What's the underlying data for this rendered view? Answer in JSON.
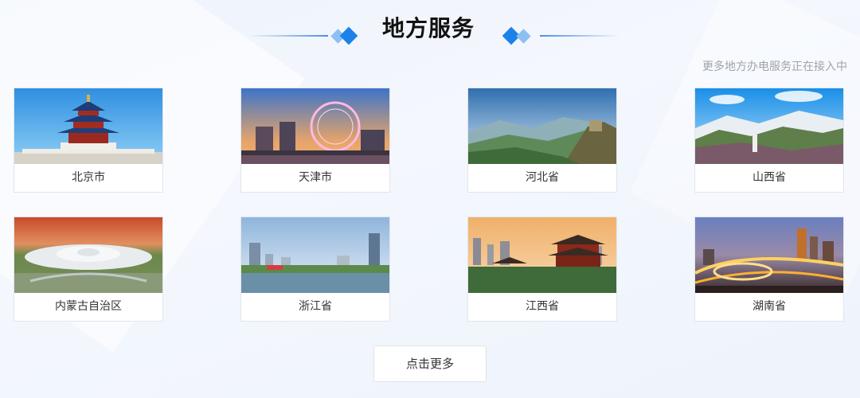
{
  "header": {
    "title": "地方服务",
    "note": "更多地方办电服务正在接入中"
  },
  "regions": [
    {
      "name": "北京市",
      "icon": "temple-of-heaven-image"
    },
    {
      "name": "天津市",
      "icon": "tianjin-eye-ferris-wheel-image"
    },
    {
      "name": "河北省",
      "icon": "great-wall-image"
    },
    {
      "name": "山西省",
      "icon": "mountain-landscape-image"
    },
    {
      "name": "内蒙古自治区",
      "icon": "airport-terminal-image"
    },
    {
      "name": "浙江省",
      "icon": "riverside-city-skyline-image"
    },
    {
      "name": "江西省",
      "icon": "tengwang-pavilion-image"
    },
    {
      "name": "湖南省",
      "icon": "night-city-interchange-image"
    }
  ],
  "more_button": "点击更多",
  "colors": {
    "accent": "#1b82e8",
    "accent_light": "#8cc0f3",
    "note": "#a0a4ab"
  }
}
